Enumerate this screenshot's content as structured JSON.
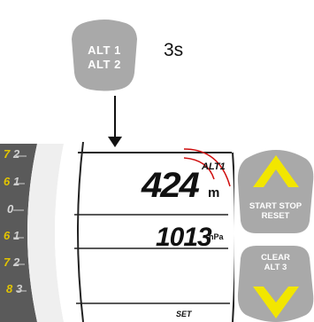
{
  "alt_button": {
    "line1": "ALT 1",
    "line2": "ALT 2"
  },
  "hold_time": "3s",
  "display": {
    "altitude_label": "ALT1",
    "altitude_value": "424",
    "altitude_unit": "m",
    "pressure_value": "1013",
    "pressure_unit": "hPa",
    "set_label": "SET"
  },
  "right_buttons": {
    "top": {
      "line1": "START STOP",
      "line2": "RESET"
    },
    "bottom": {
      "line1": "CLEAR",
      "line2": "ALT 3"
    }
  },
  "dial_ticks": [
    {
      "num": "7",
      "mark": "2",
      "color": "#e2c400"
    },
    {
      "num": "6",
      "mark": "1",
      "color": "#e2c400"
    },
    {
      "num": "",
      "mark": "0",
      "color": "#d9d9d9"
    },
    {
      "num": "6",
      "mark": "1",
      "color": "#e2c400"
    },
    {
      "num": "7",
      "mark": "2",
      "color": "#e2c400"
    },
    {
      "num": "8",
      "mark": "3",
      "color": "#e2c400"
    }
  ],
  "colors": {
    "button_gray": "#a9a9a9",
    "accent_yellow": "#f2e600",
    "signal_red": "#d01010"
  }
}
